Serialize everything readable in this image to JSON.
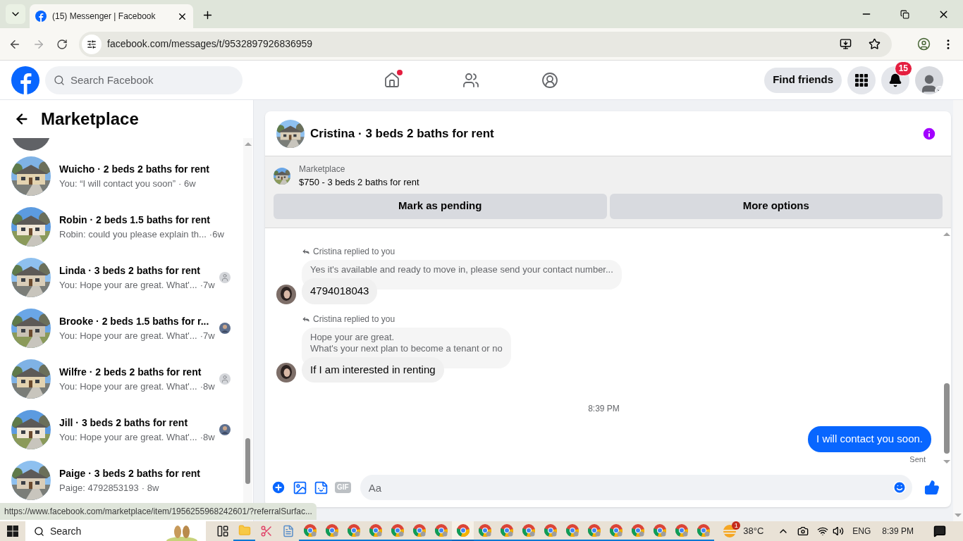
{
  "browser": {
    "tab_title": "(15) Messenger | Facebook",
    "url": "facebook.com/messages/t/9532897926836959"
  },
  "header": {
    "search_placeholder": "Search Facebook",
    "nav": [
      {
        "kind": "home",
        "dot": true
      },
      {
        "kind": "friends",
        "dot": false
      },
      {
        "kind": "groups",
        "dot": false
      }
    ],
    "find_friends": "Find friends",
    "notification_count": "15"
  },
  "sidebar": {
    "title": "Marketplace",
    "conversations": [
      {
        "title": "Wuicho · 2 beds 2 baths for rent",
        "preview": "You: “I will contact you soon”",
        "time": "· 6w",
        "kind": "plain"
      },
      {
        "title": "Robin · 2 beds 1.5 baths for rent",
        "preview": "Robin: could you please explain th...",
        "time": "·6w",
        "kind": "plain"
      },
      {
        "title": "Linda · 3 beds 2 baths for rent",
        "preview": "You: Hope your are great. What'...",
        "time": "·7w",
        "kind": "seen-default"
      },
      {
        "title": "Brooke · 2 beds 1.5 baths for r...",
        "preview": "You: Hope your are great. What'...",
        "time": "·7w",
        "kind": "seen-photo"
      },
      {
        "title": "Wilfre · 2 beds 2 baths for rent",
        "preview": "You: Hope your are great. What'...",
        "time": "·8w",
        "kind": "seen-default"
      },
      {
        "title": "Jill · 3 beds 2 baths for rent",
        "preview": "You: Hope your are great. What'...",
        "time": "·8w",
        "kind": "seen-photo"
      },
      {
        "title": "Paige · 3 beds 2 baths for rent",
        "preview": "Paige: 4792853193",
        "time": "· 8w",
        "kind": "plain"
      }
    ]
  },
  "conversation": {
    "title": "Cristina · 3 beds 2 baths for rent",
    "listing": {
      "label": "Marketplace",
      "text": "$750 - 3 beds 2 baths for rent"
    },
    "buttons": [
      "Mark as pending",
      "More options"
    ],
    "messages": [
      {
        "kind": "reply",
        "reply_label": "Cristina replied to you",
        "quoted": "Yes it's available and ready to move in, please send your contact number...",
        "text": "4794018043"
      },
      {
        "kind": "reply",
        "reply_label": "Cristina replied to you",
        "quoted": "Hope your are great.\nWhat's your next plan to become a tenant or no",
        "text": "If I am interested in renting"
      },
      {
        "kind": "time",
        "text": "8:39 PM"
      },
      {
        "kind": "sent",
        "text": "I will contact you soon.",
        "status": "Sent"
      }
    ],
    "composer": {
      "placeholder": "Aa",
      "gif": "GIF"
    }
  },
  "status_url": "https://www.facebook.com/marketplace/item/1956255968242601/?referralSurfac...",
  "taskbar": {
    "search": "Search",
    "apps": [
      {
        "kind": "task-view",
        "selected": false
      },
      {
        "kind": "explorer",
        "selected": false
      },
      {
        "kind": "snip",
        "selected": false
      },
      {
        "kind": "notepad",
        "selected": false
      },
      {
        "kind": "chrome",
        "selected": false
      },
      {
        "kind": "chrome",
        "selected": false
      },
      {
        "kind": "chrome",
        "selected": false
      },
      {
        "kind": "chrome",
        "selected": false
      },
      {
        "kind": "chrome",
        "selected": false
      },
      {
        "kind": "chrome",
        "selected": false
      },
      {
        "kind": "chrome",
        "selected": false
      },
      {
        "kind": "chrome",
        "selected": true
      },
      {
        "kind": "chrome",
        "selected": false
      },
      {
        "kind": "chrome",
        "selected": false
      },
      {
        "kind": "chrome",
        "selected": false
      },
      {
        "kind": "chrome",
        "selected": false
      },
      {
        "kind": "chrome",
        "selected": false
      },
      {
        "kind": "chrome",
        "selected": false
      },
      {
        "kind": "chrome",
        "selected": false
      },
      {
        "kind": "chrome",
        "selected": false
      },
      {
        "kind": "chrome",
        "selected": false
      },
      {
        "kind": "chrome",
        "selected": false
      },
      {
        "kind": "chrome",
        "selected": false
      }
    ],
    "weather_badge": "1",
    "temperature": "38°C",
    "language": "ENG",
    "time": "8:39 PM"
  }
}
